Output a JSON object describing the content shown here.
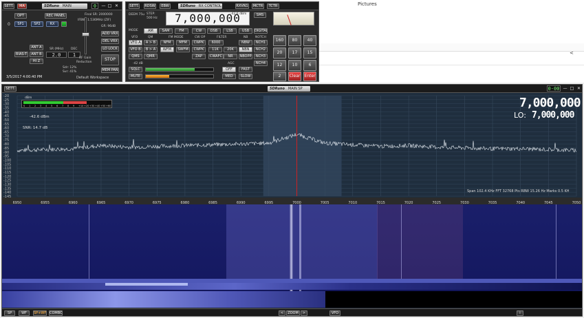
{
  "desktop": {
    "pictures_label": "Pictures",
    "chevron": "<"
  },
  "main_panel": {
    "logo": "SDRuno",
    "title": "MAIN",
    "sett": "SETT.",
    "ma": "MA",
    "lcd": "0",
    "opt": "OPT",
    "rec_panel": "REC PANEL",
    "final_sr": "Final SR: 2000000",
    "ifbw": "IFBW: 1.536MHz (ZIF)",
    "gr": "GR: 96dB",
    "zero": "0",
    "sp1": "SP1",
    "sp2": "SP2",
    "rx": "RX",
    "add_vrx": "ADD VRX",
    "del_vrx": "DEL VRX",
    "lo_lock": "LO LOCK",
    "ant_a": "ANT A",
    "bias_t": "BIAS-T",
    "ant_b": "ANT B",
    "hi_z": "HI Z",
    "sr_mhz": "SR (MHz)",
    "sr_value": "2.0",
    "dec": "DEC",
    "dec_value": "1",
    "rf_gain": "RF Gain",
    "reduction": "Reduction",
    "stop": "STOP",
    "mem_pan": "MEM PAN",
    "sdr_pct": "Sdr: 12%",
    "svr_pct": "Svr: 41%",
    "datetime": "3/5/2017 4:00:40 PM",
    "workspace": "Default Workspace"
  },
  "rx_panel": {
    "logo": "SDRuno",
    "title": "RX CONTROL",
    "sett": "SETT.",
    "rdsw": "RDSW",
    "ebw": "EBW",
    "deem": "DEEM 75u",
    "step": "STEP:",
    "step_value": "500 Hz",
    "freq": "7,000,000",
    "dbm": "-42.6 dBm",
    "sms": "SMS",
    "mode": "MODE",
    "modes": [
      "AM",
      "SAM",
      "FM",
      "CW",
      "DSB",
      "LSB",
      "USB",
      "DIGITAL"
    ],
    "vfo": "VFO",
    "qm": "QM",
    "fm_mode": "FM MODE",
    "cw_op": "CW OP",
    "filter": "FILTER",
    "nb": "NB",
    "notch": "NOTCH",
    "vfo_a": "VFO A",
    "a_b": "A > B",
    "nfm": "NFM",
    "mfm": "MFM",
    "cwpk": "CWPK",
    "f6000": "6000",
    "nbw": "NBW",
    "nch1": "NCH1",
    "vfo_b": "VFO B",
    "b_a": "B > A",
    "wfm": "WFM",
    "swfm": "SWFM",
    "cwpk2": "CWPK",
    "f11k": "11K",
    "f20k": "20K",
    "nbn": "NBN",
    "nch2": "NCH2",
    "qms": "QMS",
    "qmr": "QMR",
    "zap": "ZAP",
    "cwafc": "CWAFC",
    "nr": "NR",
    "nbopp": "NBOPP",
    "nch3": "NCH3",
    "level": "-42 dB",
    "agc": "AGC",
    "sqlc": "SQLC",
    "off": "OFF",
    "fast": "FAST",
    "nch4": "NCH4",
    "mute": "MUTE",
    "med": "MED",
    "slow": "SLOW",
    "keys": [
      "160",
      "80",
      "40",
      "20",
      "17",
      "15",
      "12",
      "10",
      "6",
      "2",
      "Clear",
      "Enter"
    ]
  },
  "toolbar_right": {
    "rxvn1": "RXVN1",
    "mctr": "MCTR",
    "tctr": "TCTR",
    "lcd": "0-00"
  },
  "sp_panel": {
    "logo": "SDRuno",
    "title": "MAIN SP",
    "sett": "SETT.",
    "lcd": "0-00",
    "dbm_label": "dBm",
    "meter_scale": [
      "S",
      "1",
      "2",
      "3",
      "4",
      "5",
      "6",
      "7",
      "8",
      "9",
      "+10",
      "+20",
      "+30",
      "+40",
      "+50",
      "+60"
    ],
    "level": "-42.6 dBm",
    "snr": "SNR: 14.7 dB",
    "freq_main": "7,000,000",
    "lo_label": "LO:",
    "lo_value": "7,000,000",
    "db_ticks": [
      "-20",
      "-25",
      "-30",
      "-35",
      "-40",
      "-45",
      "-50",
      "-55",
      "-60",
      "-65",
      "-70",
      "-75",
      "-80",
      "-85",
      "-90",
      "-95",
      "-100",
      "-105",
      "-110",
      "-115",
      "-120",
      "-125",
      "-130",
      "-135",
      "-140",
      "-145"
    ],
    "status": "Span 102.4 KHz   FFT 32768 Pts   RBW 15.26 Hz   Marks 0.5 KH",
    "freq_ticks": [
      "6950",
      "6955",
      "6960",
      "6965",
      "6970",
      "6975",
      "6980",
      "6985",
      "6990",
      "6995",
      "7000",
      "7005",
      "7010",
      "7015",
      "7020",
      "7025",
      "7030",
      "7035",
      "7040",
      "7045",
      "7050"
    ],
    "footer": {
      "sp": "SP",
      "wf": "WF",
      "sp_wf": "SP+WF",
      "combo": "COMBO",
      "zoom": "ZOOM",
      "vfo": "VFO",
      "info": "i",
      "left": "<",
      "right": ">"
    }
  },
  "chart_data": {
    "type": "line",
    "xlabel": "",
    "ylabel": "",
    "xlim": [
      6950,
      7050
    ],
    "ylim": [
      -145,
      -20
    ],
    "x": [
      6950,
      6955,
      6960,
      6965,
      6970,
      6975,
      6980,
      6985,
      6990,
      6995,
      7000,
      7005,
      7010,
      7015,
      7020,
      7025,
      7030,
      7035,
      7040,
      7045,
      7050
    ],
    "y": [
      -88,
      -87,
      -86,
      -82,
      -84,
      -83,
      -82,
      -81,
      -80,
      -79,
      -68,
      -79,
      -81,
      -83,
      -82,
      -84,
      -85,
      -86,
      -86,
      -87,
      -88
    ],
    "marker_freq": 7000
  },
  "colors": {
    "accent": "#3c5a8a",
    "marker": "#cc2222",
    "meter_green": "#33cc33",
    "meter_red": "#dd4444"
  }
}
